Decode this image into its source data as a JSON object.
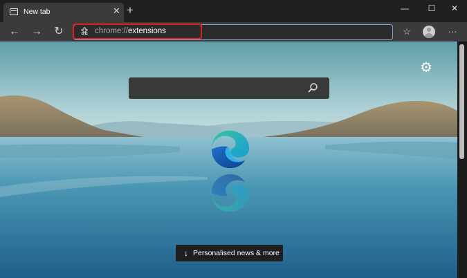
{
  "tab": {
    "title": "New tab",
    "close_glyph": "✕"
  },
  "new_tab_glyph": "+",
  "window_controls": {
    "minimize": "—",
    "maximize": "☐",
    "close": "✕"
  },
  "nav": {
    "back": "←",
    "forward": "→",
    "refresh": "↻"
  },
  "address": {
    "scheme": "chrome://",
    "path": "extensions",
    "icon": "puzzle-icon"
  },
  "toolbar_right": {
    "favorites": "☆",
    "more": "···"
  },
  "newtab_page": {
    "settings_glyph": "⚙",
    "search_placeholder": "",
    "news_arrow": "↓",
    "news_button_label": "Personalised news & more"
  },
  "colors": {
    "accent_highlight": "#e22222",
    "address_border": "#7aa6d8",
    "chrome_dark": "#202020",
    "toolbar": "#3b3b3b"
  }
}
